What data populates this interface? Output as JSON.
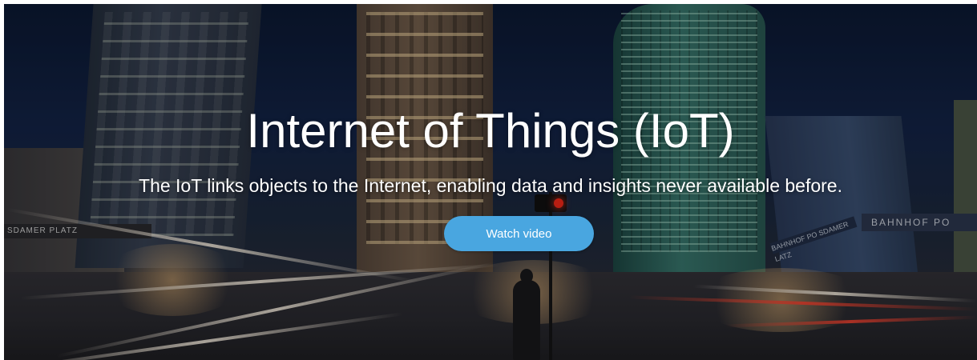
{
  "hero": {
    "title": "Internet of Things (IoT)",
    "subtitle": "The IoT links objects to the Internet, enabling data and insights never available before.",
    "cta_label": "Watch video",
    "background_description_colors": {
      "sky": "#14254a",
      "button": "#49a6e0",
      "text": "#ffffff"
    },
    "street_signs": {
      "left": "SDAMER PLATZ",
      "right": "BAHNHOF PO",
      "middle": "BAHNHOF PO SDAMER LATZ"
    }
  }
}
